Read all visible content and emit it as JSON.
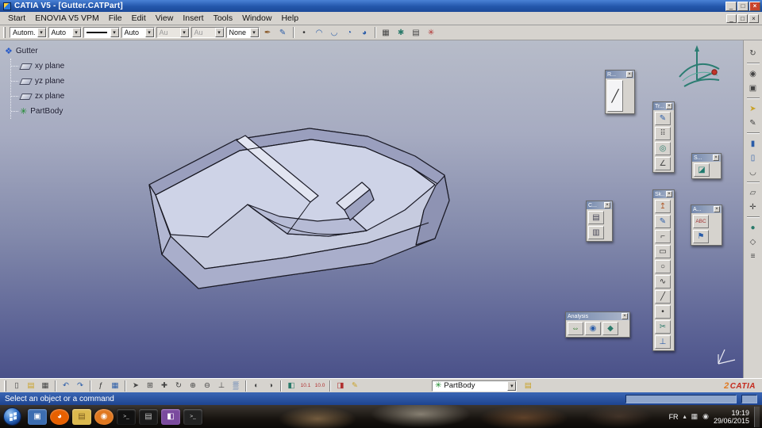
{
  "window": {
    "title": "CATIA V5 - [Gutter.CATPart]",
    "minimize_glyph": "_",
    "restore_glyph": "□",
    "close_glyph": "×"
  },
  "menubar": {
    "items": [
      "Start",
      "ENOVIA V5 VPM",
      "File",
      "Edit",
      "View",
      "Insert",
      "Tools",
      "Window",
      "Help"
    ]
  },
  "top_toolbar": {
    "combos": [
      "Autom.",
      "Auto",
      "Auto",
      "Au",
      "Au",
      "None"
    ],
    "icons": [
      {
        "name": "graphic-properties-wizard-icon",
        "glyph": "✒",
        "color": "#8a5a2a"
      },
      {
        "name": "painter-icon",
        "glyph": "✎",
        "color": "#2a5ca8"
      },
      {
        "sep": true
      },
      {
        "name": "point-snap-icon",
        "glyph": "•",
        "color": "#333333"
      },
      {
        "name": "arc-tool-icon",
        "glyph": "◠",
        "color": "#2a5ca8"
      },
      {
        "name": "arc-tool-2-icon",
        "glyph": "◡",
        "color": "#2a5ca8"
      },
      {
        "name": "revolve-view-icon",
        "glyph": "◔",
        "color": "#2a5ca8"
      },
      {
        "name": "sphere-view-icon",
        "glyph": "◕",
        "color": "#2a5ca8"
      },
      {
        "sep": true
      },
      {
        "name": "catalog-browser-icon",
        "glyph": "▦",
        "color": "#444444"
      },
      {
        "name": "link-manager-icon",
        "glyph": "✱",
        "color": "#2a7a6a"
      },
      {
        "name": "design-table-icon",
        "glyph": "▤",
        "color": "#444444"
      },
      {
        "name": "knowledge-icon",
        "glyph": "✳",
        "color": "#b03030"
      }
    ]
  },
  "tree": {
    "root": "Gutter",
    "items": [
      {
        "label": "xy plane"
      },
      {
        "label": "yz plane"
      },
      {
        "label": "zx plane"
      },
      {
        "label": "PartBody"
      }
    ]
  },
  "palettes": {
    "r": {
      "title": "R...",
      "icons": [
        {
          "name": "line-rule-icon",
          "glyph": "╱",
          "color": "#333333",
          "cls": "tall"
        }
      ]
    },
    "tr": {
      "title": "Tr...",
      "icons": [
        {
          "name": "sketch-tracer-icon",
          "glyph": "✎",
          "color": "#2a5ca8"
        },
        {
          "name": "grid-icon",
          "glyph": "⠿",
          "color": "#555555"
        },
        {
          "name": "rotate-tool-icon",
          "glyph": "◎",
          "color": "#2a7a6a"
        },
        {
          "name": "measure-between-icon",
          "glyph": "∠",
          "color": "#444444"
        }
      ]
    },
    "s": {
      "title": "S...",
      "icons": [
        {
          "name": "surface-tool-icon",
          "glyph": "◪",
          "color": "#1e7a6e"
        }
      ]
    },
    "c": {
      "title": "C...",
      "icons": [
        {
          "name": "constraint-box-icon",
          "glyph": "▤",
          "color": "#444455"
        },
        {
          "name": "contact-constraint-icon",
          "glyph": "▥",
          "color": "#444455"
        }
      ]
    },
    "sk": {
      "title": "Sk...",
      "icons": [
        {
          "name": "exit-workbench-icon",
          "glyph": "↥",
          "color": "#b05a2a"
        },
        {
          "name": "sketcher-icon",
          "glyph": "✎",
          "color": "#2a5ca8"
        },
        {
          "name": "profile-icon",
          "glyph": "⌐",
          "color": "#333333"
        },
        {
          "name": "rectangle-icon",
          "glyph": "▭",
          "color": "#333333"
        },
        {
          "name": "circle-icon",
          "glyph": "○",
          "color": "#333333"
        },
        {
          "name": "spline-icon",
          "glyph": "∿",
          "color": "#333333"
        },
        {
          "name": "line-icon",
          "glyph": "╱",
          "color": "#333333"
        },
        {
          "name": "point-icon",
          "glyph": "•",
          "color": "#333333"
        },
        {
          "name": "trim-icon",
          "glyph": "✂",
          "color": "#2a7a6a"
        },
        {
          "name": "constraint-icon",
          "glyph": "⊥",
          "color": "#2a5ca8"
        }
      ]
    },
    "a": {
      "title": "A...",
      "icons": [
        {
          "name": "annotation-text-icon",
          "glyph": "ABC",
          "color": "#a33333",
          "small": true
        },
        {
          "name": "flag-note-icon",
          "glyph": "⚑",
          "color": "#2a5ca8"
        }
      ]
    },
    "analysis": {
      "title": "Analysis",
      "icons": [
        {
          "name": "connect-checker-icon",
          "glyph": "⇔",
          "color": "#2a7a2a"
        },
        {
          "name": "curvature-analysis-icon",
          "glyph": "◉",
          "color": "#2a5ca8"
        },
        {
          "name": "distance-analysis-icon",
          "glyph": "◆",
          "color": "#2a7a6a"
        }
      ]
    }
  },
  "right_rail": {
    "icons": [
      {
        "name": "update-icon",
        "glyph": "↻",
        "color": "#444444"
      },
      {
        "sep": true
      },
      {
        "name": "camera-view-icon",
        "glyph": "◉",
        "color": "#444444"
      },
      {
        "name": "clipboard-icon",
        "glyph": "▣",
        "color": "#444444"
      },
      {
        "sep": true
      },
      {
        "name": "select-cursor-icon",
        "glyph": "➤",
        "color": "#c9a227"
      },
      {
        "name": "pen-annotation-icon",
        "glyph": "✎",
        "color": "#444444"
      },
      {
        "sep": true
      },
      {
        "name": "pad-extrude-icon",
        "glyph": "▮",
        "color": "#2a5ca8"
      },
      {
        "name": "pocket-icon",
        "glyph": "▯",
        "color": "#2a5ca8"
      },
      {
        "name": "fillet-icon",
        "glyph": "◡",
        "color": "#444444"
      },
      {
        "sep": true
      },
      {
        "name": "plane-tool-icon",
        "glyph": "▱",
        "color": "#444444"
      },
      {
        "name": "axis-system-icon",
        "glyph": "✛",
        "color": "#444444"
      },
      {
        "sep": true
      },
      {
        "name": "shaded-view-icon",
        "glyph": "●",
        "color": "#2a7a6a"
      },
      {
        "name": "wireframe-view-icon",
        "glyph": "◇",
        "color": "#444444"
      },
      {
        "name": "measure-stack-icon",
        "glyph": "≡",
        "color": "#444444"
      }
    ]
  },
  "bottom_toolbar": {
    "icons": [
      {
        "name": "new-file-icon",
        "glyph": "▯",
        "color": "#444444"
      },
      {
        "name": "open-icon",
        "glyph": "▤",
        "color": "#c9a227"
      },
      {
        "name": "print-icon",
        "glyph": "▦",
        "color": "#444444"
      },
      {
        "sep": true
      },
      {
        "name": "undo-icon",
        "glyph": "↶",
        "color": "#2a5ca8"
      },
      {
        "name": "redo-icon",
        "glyph": "↷",
        "color": "#2a5ca8"
      },
      {
        "sep": true
      },
      {
        "name": "formula-fx-icon",
        "glyph": "ƒ",
        "color": "#333333"
      },
      {
        "name": "design-table-icon",
        "glyph": "▦",
        "color": "#2a5ca8"
      },
      {
        "sep": true
      },
      {
        "name": "fly-mode-icon",
        "glyph": "➤",
        "color": "#444444"
      },
      {
        "name": "fit-all-in-icon",
        "glyph": "⊞",
        "color": "#444444"
      },
      {
        "name": "pan-icon",
        "glyph": "✚",
        "color": "#444444"
      },
      {
        "name": "rotate-icon",
        "glyph": "↻",
        "color": "#444444"
      },
      {
        "name": "zoom-in-icon",
        "glyph": "⊕",
        "color": "#444444"
      },
      {
        "name": "zoom-out-icon",
        "glyph": "⊖",
        "color": "#444444"
      },
      {
        "name": "normal-view-icon",
        "glyph": "⊥",
        "color": "#444444"
      },
      {
        "name": "multi-view-icon",
        "glyph": "▒",
        "color": "#2a5ca8"
      },
      {
        "sep": true
      },
      {
        "name": "hide-show-icon",
        "glyph": "◐",
        "color": "#444444"
      },
      {
        "name": "swap-visible-space-icon",
        "glyph": "◑",
        "color": "#444444"
      },
      {
        "sep": true
      },
      {
        "name": "shading-mode-icon",
        "glyph": "◧",
        "color": "#2a7a6a"
      },
      {
        "name": "measure-10-1-icon",
        "glyph": "10.1",
        "color": "#b03030",
        "small": true
      },
      {
        "name": "measure-10-0-icon",
        "glyph": "10.0",
        "color": "#b03030",
        "small": true
      },
      {
        "sep": true
      },
      {
        "name": "paint-bucket-icon",
        "glyph": "◨",
        "color": "#b03030"
      },
      {
        "name": "pencil-edit-icon",
        "glyph": "✎",
        "color": "#c9a227"
      }
    ],
    "partbody_combo": "PartBody",
    "logo_swoosh": "2",
    "logo": "CATIA"
  },
  "statusbar": {
    "message": "Select an object or a command"
  },
  "taskbar": {
    "lang": "FR",
    "hidden_icons_glyph": "▴",
    "network_glyph": "▦",
    "volume_glyph": "◉",
    "time": "19:19",
    "date": "29/06/2015",
    "apps": [
      {
        "name": "catia-taskbar-icon",
        "glyph": "▣",
        "bg": "#3c6db0"
      },
      {
        "name": "firefox-icon",
        "glyph": "◕",
        "bg": "#e66000",
        "cls": "round"
      },
      {
        "name": "folder-icon",
        "glyph": "▤",
        "bg": "#dcb94e",
        "color": "#7a5c1e"
      },
      {
        "name": "media-player-icon",
        "glyph": "◉",
        "bg": "#e07820",
        "cls": "round"
      },
      {
        "name": "console-icon",
        "glyph": ">_",
        "bg": "#111111",
        "color": "#dddddd",
        "small": true
      },
      {
        "name": "notepad-icon",
        "glyph": "▤",
        "bg": "#1a1a1a",
        "color": "#bbbbbb"
      },
      {
        "name": "paint-app-icon",
        "glyph": "◧",
        "bg": "#7a4a9e"
      },
      {
        "name": "console-2-icon",
        "glyph": ">_",
        "bg": "#222222",
        "color": "#dddddd",
        "small": true
      }
    ]
  },
  "icons": {
    "combo_arrow": "▾",
    "close_small": "×",
    "part_root": "❖",
    "partbody_gear": "✳"
  }
}
